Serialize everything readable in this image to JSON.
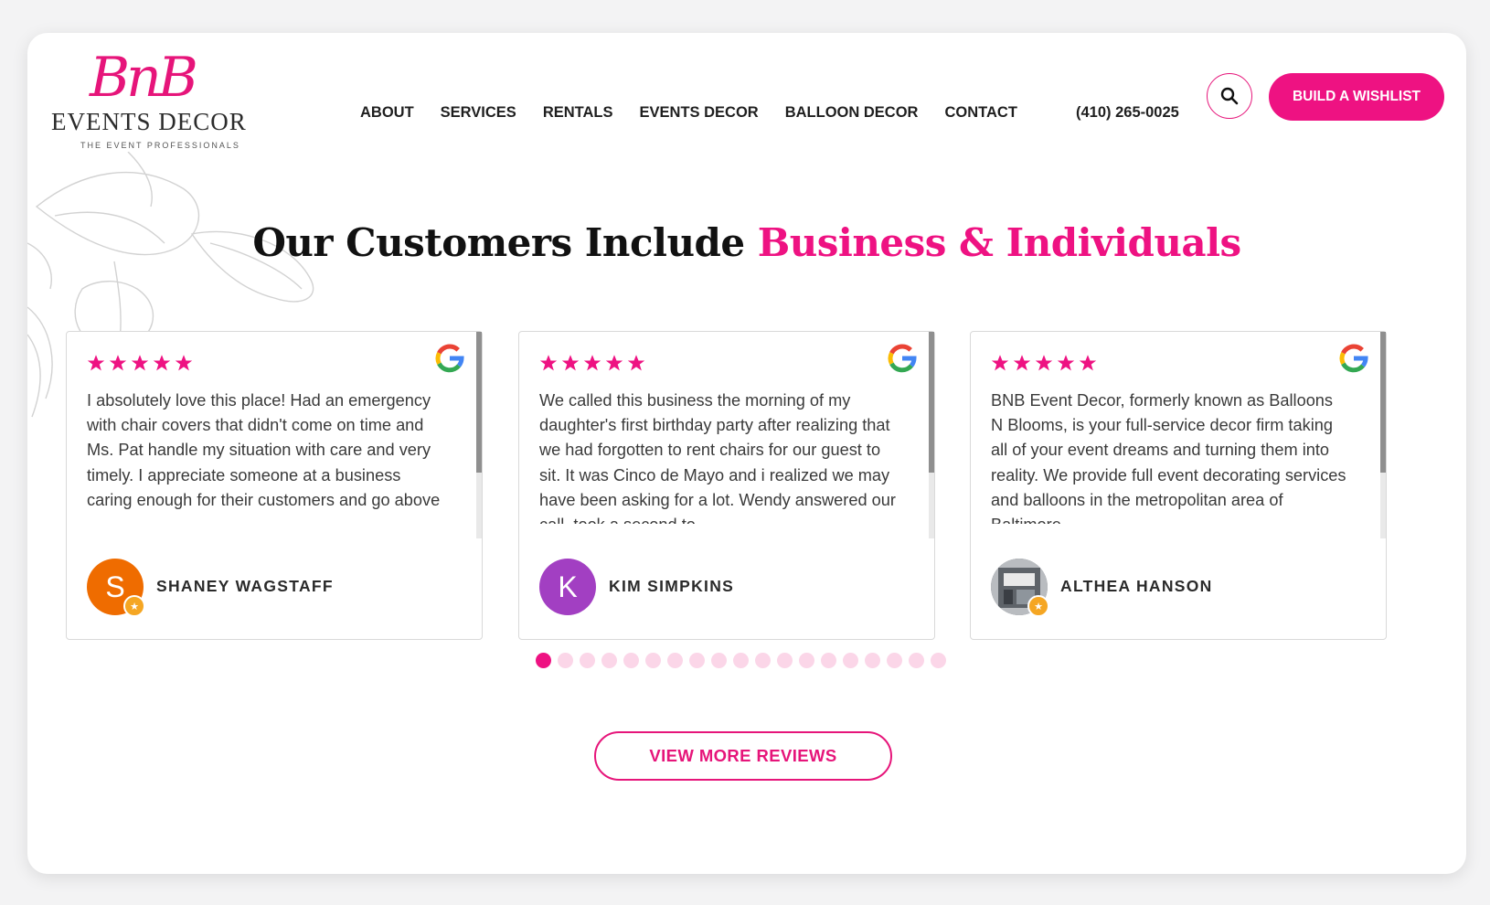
{
  "logo": {
    "script": "BnB",
    "main": "EVENTS DECOR",
    "tagline": "THE EVENT PROFESSIONALS"
  },
  "nav": {
    "items": [
      "ABOUT",
      "SERVICES",
      "RENTALS",
      "EVENTS DECOR",
      "BALLOON DECOR",
      "CONTACT"
    ],
    "phone": "(410) 265-0025",
    "search_icon": "search-icon",
    "wishlist_label": "BUILD A WISHLIST"
  },
  "section": {
    "heading_plain": "Our Customers Include ",
    "heading_accent": "Business & Individuals"
  },
  "reviews": [
    {
      "rating": 5,
      "source_icon": "google-icon",
      "text": "I absolutely love this place! Had an emergency with chair covers that didn't come on time and Ms. Pat handle my situation with care and very timely. I appreciate someone at a business caring enough for their customers and go above",
      "avatar_letter": "S",
      "avatar_color": "#ef6c00",
      "reviewer": "SHANEY WAGSTAFF"
    },
    {
      "rating": 5,
      "source_icon": "google-icon",
      "text": "We called this business the morning of my daughter's first birthday party after realizing that we had forgotten to rent chairs for our guest to sit. It was Cinco de Mayo and i realized we may have been asking for a lot. Wendy answered our call, took a second to",
      "avatar_letter": "K",
      "avatar_color": "#a23fc2",
      "reviewer": "KIM SIMPKINS"
    },
    {
      "rating": 5,
      "source_icon": "google-icon",
      "text": "BNB Event Decor, formerly known as Balloons N Blooms, is your full-service decor firm taking all of your event dreams and turning them into reality. We provide full event decorating services and balloons in the metropolitan area of Baltimore,",
      "avatar_letter": "",
      "avatar_color": "#7a7f86",
      "reviewer": "ALTHEA HANSON"
    }
  ],
  "carousel": {
    "dot_count": 19,
    "active_index": 0
  },
  "view_more_label": "VIEW MORE REVIEWS",
  "colors": {
    "accent": "#ee1282",
    "dot_inactive": "#fbd6e8"
  }
}
